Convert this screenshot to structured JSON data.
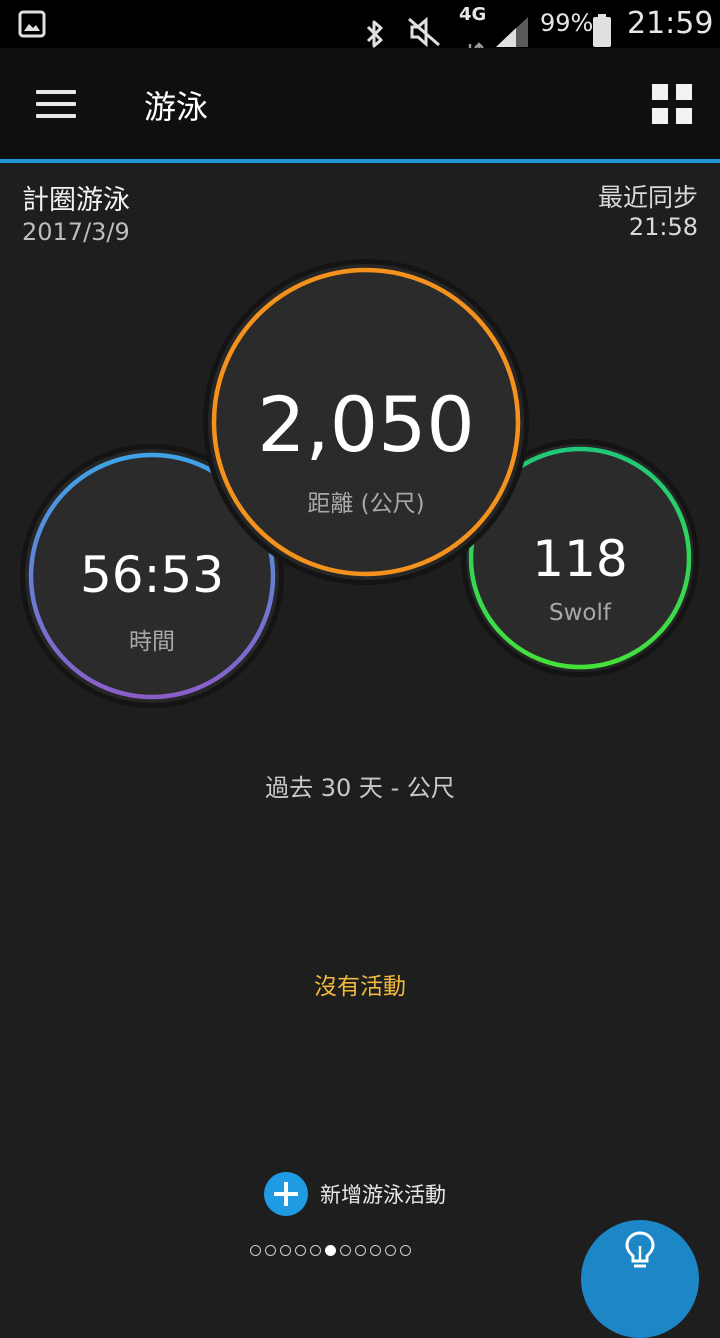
{
  "status_bar": {
    "network": "4G",
    "battery_percent": "99%",
    "time": "21:59",
    "icons": [
      "gallery-icon",
      "bluetooth-icon",
      "mute-icon",
      "data-arrows-icon",
      "signal-icon",
      "battery-icon"
    ]
  },
  "app_bar": {
    "title": "游泳",
    "icons": [
      "menu-icon",
      "grid-view-icon"
    ]
  },
  "activity": {
    "type": "計圈游泳",
    "date": "2017/3/9",
    "sync_label": "最近同步",
    "sync_time": "21:58"
  },
  "metrics": {
    "time": {
      "value": "56:53",
      "label": "時間"
    },
    "distance": {
      "value": "2,050",
      "label": "距離 (公尺)"
    },
    "swolf": {
      "value": "118",
      "label": "Swolf"
    }
  },
  "colors": {
    "accent": "#2196d9",
    "time_ring_start": "#3fa3e6",
    "time_ring_end": "#8a5ec8",
    "distance_ring": "#f5921e",
    "swolf_ring_start": "#21c779",
    "swolf_ring_end": "#44e13a",
    "no_activity": "#f0b93a"
  },
  "period_label": "過去 30 天 - 公尺",
  "no_activity_text": "沒有活動",
  "add_button": {
    "label": "新增游泳活動",
    "icon": "plus-icon"
  },
  "pager": {
    "total_pages": 11,
    "current_page": 6
  },
  "fab": {
    "icon": "lightbulb-icon"
  }
}
